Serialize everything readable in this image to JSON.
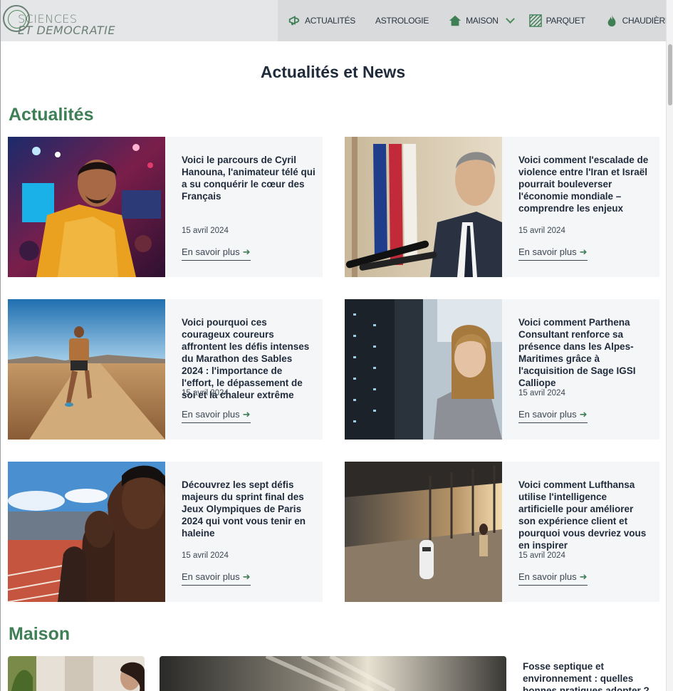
{
  "logo": {
    "line1": "SCIENCES",
    "line2": "ET DEMOCRATIE"
  },
  "nav": [
    {
      "label": "ACTUALITÉS",
      "icon": "megaphone-icon",
      "dropdown": false
    },
    {
      "label": "ASTROLOGIE",
      "icon": "",
      "dropdown": false
    },
    {
      "label": "MAISON",
      "icon": "house-icon",
      "dropdown": true
    },
    {
      "label": "PARQUET",
      "icon": "parquet-icon",
      "dropdown": false
    },
    {
      "label": "CHAUDIÈRE",
      "icon": "flame-icon",
      "dropdown": true
    }
  ],
  "page_title": "Actualités et News",
  "sections": {
    "actualites": "Actualités",
    "maison": "Maison"
  },
  "articles": [
    {
      "title": "Voici le parcours de Cyril Hanouna, l'animateur télé qui a su conquérir le cœur des Français",
      "date": "15 avril 2024",
      "more": "En savoir plus"
    },
    {
      "title": "Voici comment l'escalade de violence entre l'Iran et Israël pourrait bouleverser l'économie mondiale – comprendre les enjeux",
      "date": "15 avril 2024",
      "more": "En savoir plus"
    },
    {
      "title": "Voici pourquoi ces courageux coureurs affrontent les défis intenses du Marathon des Sables 2024 : l'importance de l'effort, le dépassement de soi et la chaleur extrême",
      "date": "15 avril 2024",
      "more": "En savoir plus"
    },
    {
      "title": "Voici comment Parthena Consultant renforce sa présence dans les Alpes-Maritimes grâce à l'acquisition de Sage IGSI Calliope",
      "date": "15 avril 2024",
      "more": "En savoir plus"
    },
    {
      "title": "Découvrez les sept défis majeurs du sprint final des Jeux Olympiques de Paris 2024 qui vont vous tenir en haleine",
      "date": "15 avril 2024",
      "more": "En savoir plus"
    },
    {
      "title": "Voici comment Lufthansa utilise l'intelligence artificielle pour améliorer son expérience client et pourquoi vous devriez vous en inspirer",
      "date": "15 avril 2024",
      "more": "En savoir plus"
    }
  ],
  "maison_article": {
    "title": "Fosse septique et environnement : quelles bonnes pratiques adopter ?"
  },
  "colors": {
    "accent": "#3f7f55",
    "nav_bg": "#d9dadb",
    "card_bg": "#f4f6f8",
    "heading": "#1f2a3a"
  }
}
